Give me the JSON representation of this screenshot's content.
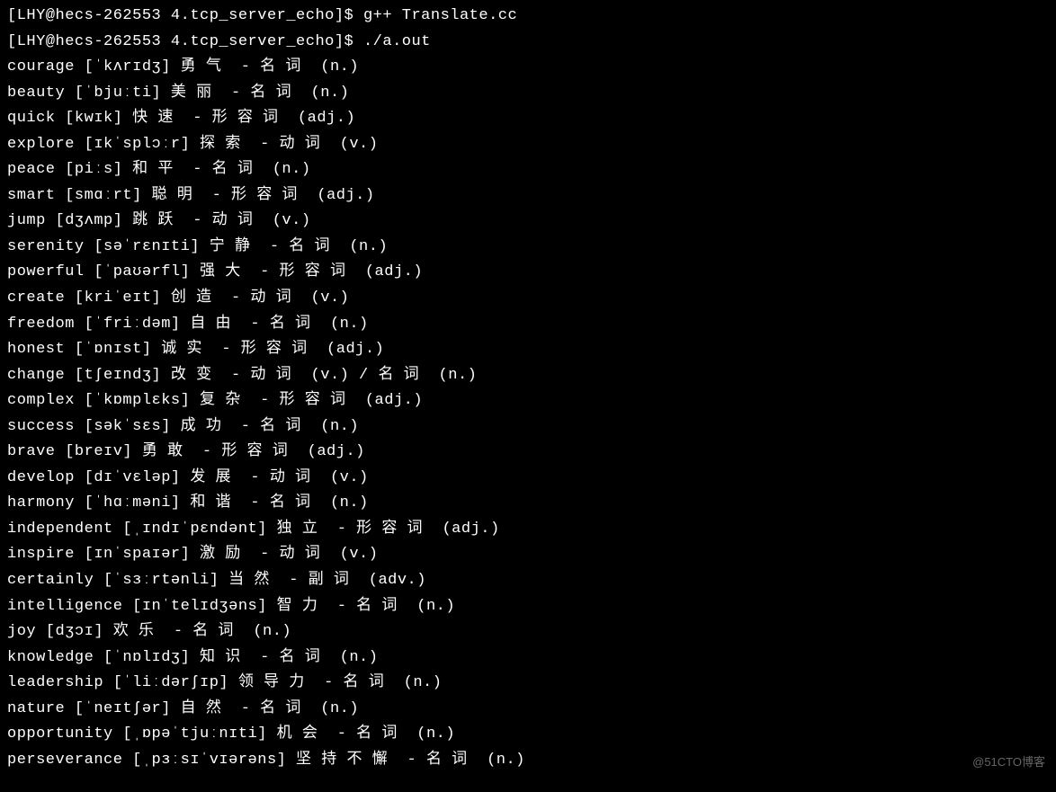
{
  "prompt1": {
    "user": "LHY",
    "host": "hecs-262553",
    "dir": "4.tcp_server_echo",
    "command": "g++ Translate.cc"
  },
  "prompt2": {
    "user": "LHY",
    "host": "hecs-262553",
    "dir": "4.tcp_server_echo",
    "command": "./a.out"
  },
  "entries": [
    "courage [ˈkʌrɪdʒ] 勇 气  - 名 词  (n.)",
    "beauty [ˈbjuːti] 美 丽  - 名 词  (n.)",
    "quick [kwɪk] 快 速  - 形 容 词  (adj.)",
    "explore [ɪkˈsplɔːr] 探 索  - 动 词  (v.)",
    "peace [piːs] 和 平  - 名 词  (n.)",
    "smart [smɑːrt] 聪 明  - 形 容 词  (adj.)",
    "jump [dʒʌmp] 跳 跃  - 动 词  (v.)",
    "serenity [səˈrɛnɪti] 宁 静  - 名 词  (n.)",
    "powerful [ˈpaʊərfl] 强 大  - 形 容 词  (adj.)",
    "create [kriˈeɪt] 创 造  - 动 词  (v.)",
    "freedom [ˈfriːdəm] 自 由  - 名 词  (n.)",
    "honest [ˈɒnɪst] 诚 实  - 形 容 词  (adj.)",
    "change [tʃeɪndʒ] 改 变  - 动 词  (v.) / 名 词  (n.)",
    "complex [ˈkɒmplɛks] 复 杂  - 形 容 词  (adj.)",
    "success [səkˈsɛs] 成 功  - 名 词  (n.)",
    "brave [breɪv] 勇 敢  - 形 容 词  (adj.)",
    "develop [dɪˈvɛləp] 发 展  - 动 词  (v.)",
    "harmony [ˈhɑːməni] 和 谐  - 名 词  (n.)",
    "independent [ˌɪndɪˈpɛndənt] 独 立  - 形 容 词  (adj.)",
    "inspire [ɪnˈspaɪər] 激 励  - 动 词  (v.)",
    "certainly [ˈsɜːrtənli] 当 然  - 副 词  (adv.)",
    "intelligence [ɪnˈtelɪdʒəns] 智 力  - 名 词  (n.)",
    "joy [dʒɔɪ] 欢 乐  - 名 词  (n.)",
    "knowledge [ˈnɒlɪdʒ] 知 识  - 名 词  (n.)",
    "leadership [ˈliːdərʃɪp] 领 导 力  - 名 词  (n.)",
    "nature [ˈneɪtʃər] 自 然  - 名 词  (n.)",
    "opportunity [ˌɒpəˈtjuːnɪti] 机 会  - 名 词  (n.)",
    "perseverance [ˌpɜːsɪˈvɪərəns] 坚 持 不 懈  - 名 词  (n.)"
  ],
  "watermark": "@51CTO博客"
}
